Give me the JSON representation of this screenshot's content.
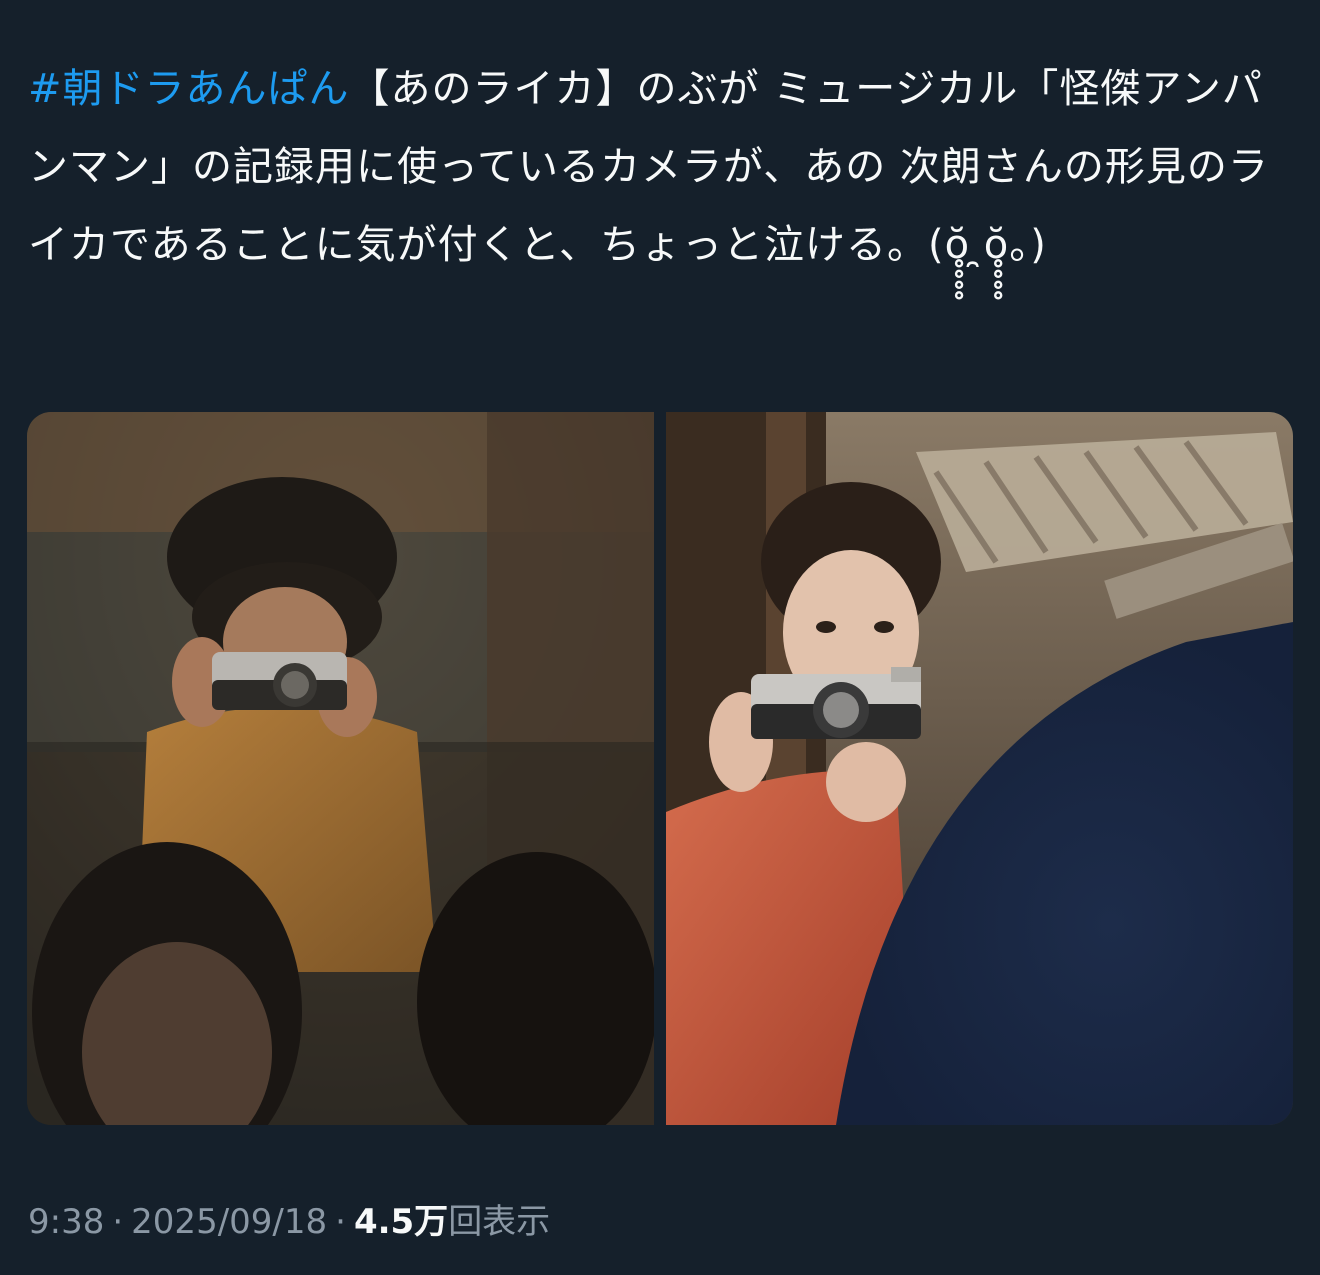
{
  "tweet": {
    "hashtag": "#朝ドラあんぱん",
    "body": "【あのライカ】のぶが ミュージカル「怪傑アンパンマン」の記録用に使っているカメラが、あの 次朗さんの形見のライカであることに気が付くと、ちょっと泣ける。(ŏ̥̥̥̥ ̯ŏ̥̥̥̥。)"
  },
  "media": [
    {
      "alt": ""
    },
    {
      "alt": ""
    }
  ],
  "meta": {
    "time": "9:38",
    "separator": "·",
    "date": "2025/09/18",
    "views_count": "4.5万",
    "views_label": "回表示"
  },
  "colors": {
    "background": "#15202b",
    "text": "#f7f9f9",
    "link": "#1d9bf0",
    "secondary": "#8b98a5"
  }
}
